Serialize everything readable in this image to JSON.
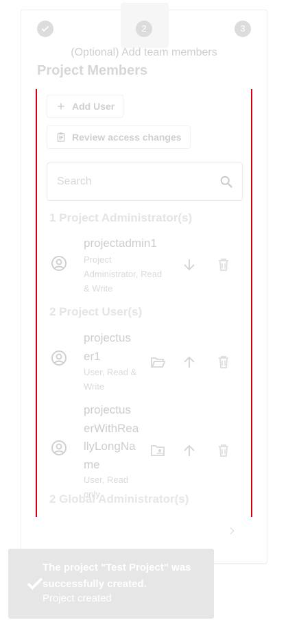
{
  "stepper": {
    "step2": "2",
    "step3": "3",
    "label": "(Optional) Add team members"
  },
  "page": {
    "title": "Project Members"
  },
  "actions": {
    "add_user": "Add User",
    "review_access": "Review access changes"
  },
  "search": {
    "placeholder": "Search"
  },
  "sections": {
    "admins": "1 Project Administrator(s)",
    "users": "2 Project User(s)",
    "global": "2 Global Administrator(s)"
  },
  "admins": [
    {
      "name": "projectadmin1",
      "role_lines": [
        "Project",
        "Administrator, Read",
        "& Write"
      ]
    }
  ],
  "users": [
    {
      "name_lines": [
        "projectus",
        "er1"
      ],
      "role_lines": [
        "User, Read &",
        "Write"
      ]
    },
    {
      "name_lines": [
        "projectus",
        "erWithRea",
        "llyLongNa",
        "me"
      ],
      "role_lines": [
        "User, Read",
        "only"
      ]
    }
  ],
  "toast": {
    "line1": "The project \"Test Project\" was",
    "line2": "successfully created.",
    "sub": "Project created"
  },
  "colors": {
    "error_border": "#d8000c",
    "toast_bg": "#e6e6e6"
  }
}
